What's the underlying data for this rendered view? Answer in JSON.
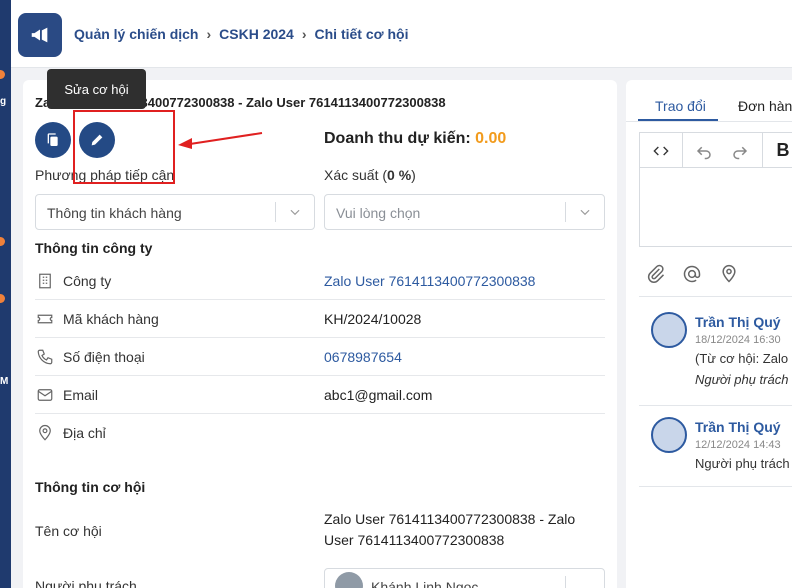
{
  "breadcrumb": {
    "item1": "Quản lý chiến dịch",
    "item2": "CSKH 2024",
    "item3": "Chi tiết cơ hội"
  },
  "sidebar_fragments": [
    "g",
    "M"
  ],
  "opportunity": {
    "title": "Zalo User 7614113400772300838 - Zalo User 7614113400772300838",
    "tooltip": "Sửa cơ hội",
    "revenue_label": "Doanh thu dự kiến:",
    "revenue_value": "0.00",
    "approach_label": "Phương pháp tiếp cận",
    "approach_value": "Thông tin khách hàng",
    "probability_label": "Xác suất (",
    "probability_value": "0 %",
    "probability_close": ")",
    "probability_placeholder": "Vui lòng chọn"
  },
  "company_section": {
    "title": "Thông tin công ty",
    "rows": [
      {
        "label": "Công ty",
        "value": "Zalo User 7614113400772300838",
        "icon": "building-icon"
      },
      {
        "label": "Mã khách hàng",
        "value": "KH/2024/10028",
        "icon": "ticket-icon"
      },
      {
        "label": "Số điện thoại",
        "value": "0678987654",
        "icon": "phone-icon"
      },
      {
        "label": "Email",
        "value": "abc1@gmail.com",
        "icon": "mail-icon"
      },
      {
        "label": "Địa chỉ",
        "value": "",
        "icon": "location-icon"
      }
    ]
  },
  "opp_section": {
    "title": "Thông tin cơ hội",
    "name_label": "Tên cơ hội",
    "name_value_line1": "Zalo User 7614113400772300838 - Zalo",
    "name_value_line2": "User 7614113400772300838",
    "owner_label": "Người phụ trách",
    "owner_value": "Khánh Linh Ngọc"
  },
  "right_panel": {
    "tabs": [
      "Trao đổi",
      "Đơn hàng"
    ],
    "comments": [
      {
        "name": "Trần Thị Quý",
        "time": "18/12/2024 16:30",
        "line1": "(Từ cơ hội: Zalo",
        "line2": "Người phụ trách"
      },
      {
        "name": "Trần Thị Quý",
        "time": "12/12/2024 14:43",
        "line1": "Người phụ trách",
        "line2": ""
      }
    ]
  },
  "colors": {
    "brand": "#244a85",
    "accent": "#f29b1c",
    "link": "#2d5aa0",
    "annotation": "#e02020"
  }
}
